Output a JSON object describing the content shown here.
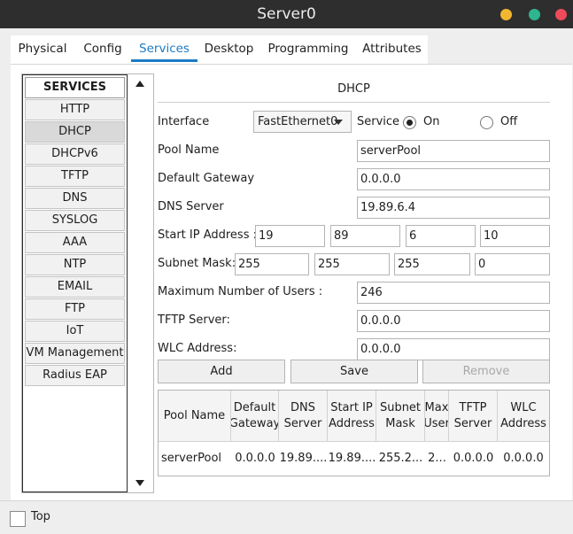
{
  "window": {
    "title": "Server0"
  },
  "tabs": [
    "Physical",
    "Config",
    "Services",
    "Desktop",
    "Programming",
    "Attributes"
  ],
  "services": {
    "header": "SERVICES",
    "items": [
      "HTTP",
      "DHCP",
      "DHCPv6",
      "TFTP",
      "DNS",
      "SYSLOG",
      "AAA",
      "NTP",
      "EMAIL",
      "FTP",
      "IoT",
      "VM Management",
      "Radius EAP"
    ],
    "selected": "DHCP"
  },
  "dhcp": {
    "title": "DHCP",
    "interface_label": "Interface",
    "interface_value": "FastEthernet0",
    "service_label": "Service",
    "on_label": "On",
    "off_label": "Off",
    "service_state": "On",
    "pool_name_label": "Pool Name",
    "pool_name": "serverPool",
    "default_gateway_label": "Default Gateway",
    "default_gateway": "0.0.0.0",
    "dns_server_label": "DNS Server",
    "dns_server": "19.89.6.4",
    "start_ip_label": "Start IP Address :",
    "start_ip": [
      "19",
      "89",
      "6",
      "10"
    ],
    "subnet_mask_label": "Subnet Mask:",
    "subnet_mask": [
      "255",
      "255",
      "255",
      "0"
    ],
    "max_users_label": "Maximum Number of Users :",
    "max_users": "246",
    "tftp_label": "TFTP Server:",
    "tftp_server": "0.0.0.0",
    "wlc_label": "WLC Address:",
    "wlc_address": "0.0.0.0",
    "buttons": {
      "add": "Add",
      "save": "Save",
      "remove": "Remove"
    }
  },
  "table": {
    "headers": [
      "Pool Name",
      "Default Gateway",
      "DNS Server",
      "Start IP Address",
      "Subnet Mask",
      "Max User",
      "TFTP Server",
      "WLC Address"
    ],
    "rows": [
      [
        "serverPool",
        "0.0.0.0",
        "19.89....",
        "19.89....",
        "255.2...",
        "2...",
        "0.0.0.0",
        "0.0.0.0"
      ]
    ]
  },
  "footer": {
    "top_label": "Top"
  },
  "colors": {
    "accent": "#1c7bc4",
    "titlebar": "#2e2e2e"
  }
}
